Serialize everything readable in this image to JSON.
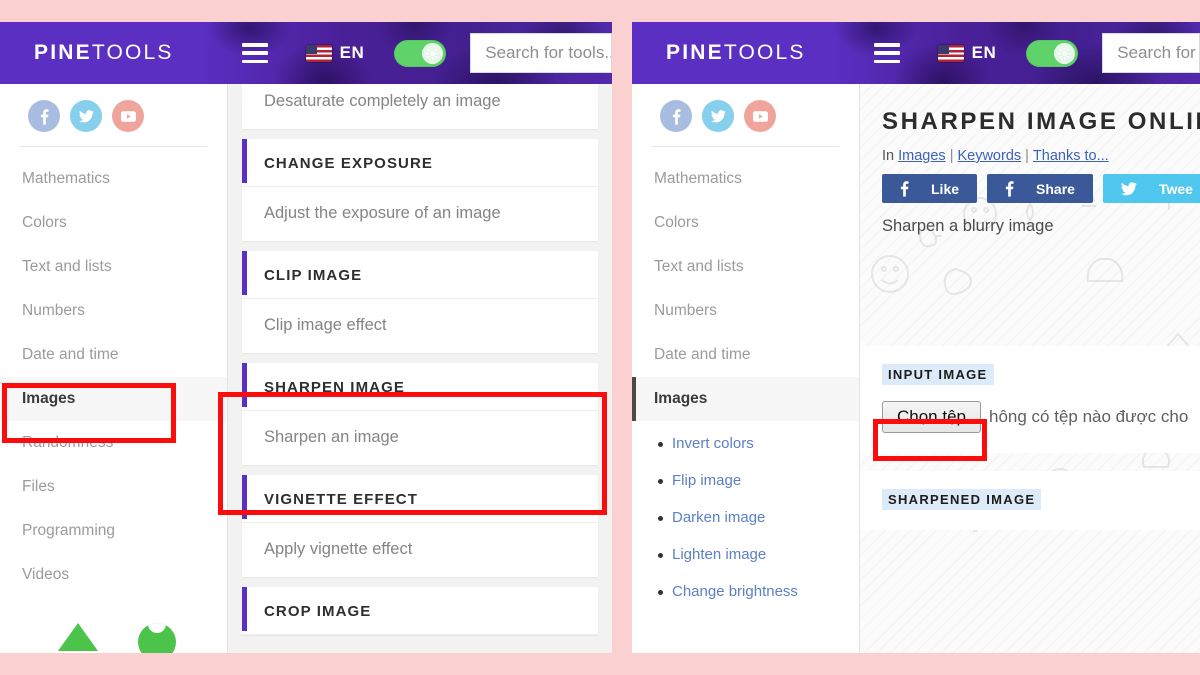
{
  "site": {
    "brand_bold": "PINE",
    "brand_light": "TOOLS",
    "lang_code": "EN",
    "search_placeholder": "Search for tools...",
    "search_placeholder_right": "Search for"
  },
  "icons": {
    "menu": "hamburger-icon",
    "flag": "us-flag-icon",
    "theme": "theme-toggle-icon",
    "facebook": "facebook-icon",
    "twitter": "twitter-icon",
    "youtube": "youtube-icon"
  },
  "sidebar": {
    "items": [
      {
        "label": "Mathematics",
        "active": false
      },
      {
        "label": "Colors",
        "active": false
      },
      {
        "label": "Text and lists",
        "active": false
      },
      {
        "label": "Numbers",
        "active": false
      },
      {
        "label": "Date and time",
        "active": false
      },
      {
        "label": "Images",
        "active": true
      },
      {
        "label": "Randomness",
        "active": false
      },
      {
        "label": "Files",
        "active": false
      },
      {
        "label": "Programming",
        "active": false
      },
      {
        "label": "Videos",
        "active": false
      }
    ],
    "images_sublinks": [
      "Invert colors",
      "Flip image",
      "Darken image",
      "Lighten image",
      "Change brightness"
    ]
  },
  "left_panel": {
    "tools": [
      {
        "title": "",
        "desc": "Desaturate completely an image",
        "partial": true
      },
      {
        "title": "CHANGE EXPOSURE",
        "desc": "Adjust the exposure of an image",
        "partial": false
      },
      {
        "title": "CLIP IMAGE",
        "desc": "Clip image effect",
        "partial": false
      },
      {
        "title": "SHARPEN IMAGE",
        "desc": "Sharpen an image",
        "partial": false
      },
      {
        "title": "VIGNETTE EFFECT",
        "desc": "Apply vignette effect",
        "partial": false
      },
      {
        "title": "CROP IMAGE",
        "desc": "",
        "partial": false
      }
    ]
  },
  "right_panel": {
    "page_title": "SHARPEN IMAGE ONLINE",
    "breadcrumb_prefix": "In",
    "breadcrumb_links": [
      "Images",
      "Keywords",
      "Thanks to..."
    ],
    "share_buttons": [
      {
        "label": "Like",
        "network": "facebook"
      },
      {
        "label": "Share",
        "network": "facebook"
      },
      {
        "label": "Twee",
        "network": "twitter"
      }
    ],
    "lead_text": "Sharpen a blurry image",
    "sections": [
      {
        "label": "INPUT IMAGE",
        "file_button": "Chọn tệp",
        "file_status": "hông có tệp nào được cho"
      },
      {
        "label": "SHARPENED IMAGE"
      }
    ]
  },
  "annotations": {
    "highlight_color": "#fc0d0d",
    "boxes": [
      "images-sidebar-item",
      "sharpen-image-card",
      "choose-file-button"
    ]
  },
  "colors": {
    "page_background": "#fbd0d0",
    "brand_purple": "#5a2fc2",
    "accent_green": "#5fd36a",
    "link_blue": "#3d62b5"
  }
}
